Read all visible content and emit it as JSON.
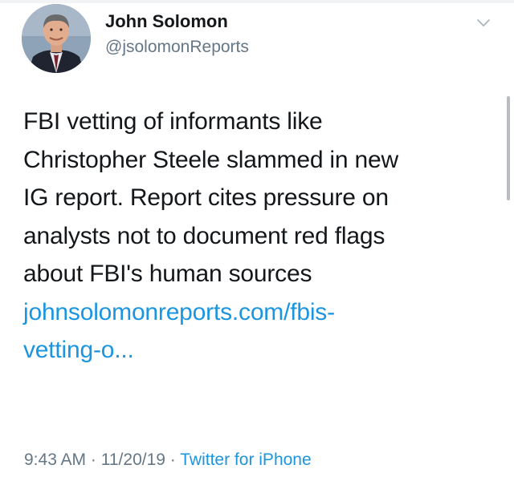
{
  "author": {
    "name": "John Solomon",
    "handle": "@jsolomonReports"
  },
  "tweet": {
    "lines": [
      "FBI vetting of informants like",
      "Christopher Steele slammed in new",
      "IG report. Report cites pressure on",
      "analysts not to document red flags",
      "about FBI's human sources"
    ],
    "link_lines": [
      "johnsolomonreports.com/fbis-",
      "vetting-o..."
    ]
  },
  "meta": {
    "time": "9:43 AM",
    "separator": "·",
    "date": "11/20/19",
    "source": "Twitter for iPhone"
  },
  "icons": {
    "menu": "chevron-down-icon",
    "avatar": "avatar"
  },
  "colors": {
    "link": "#1b95e0",
    "secondary_text": "#657786",
    "primary_text": "#14171a"
  }
}
